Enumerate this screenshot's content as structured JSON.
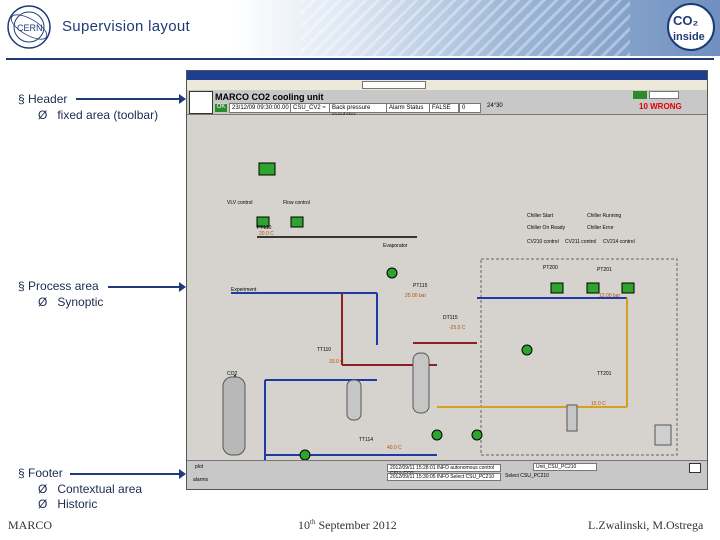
{
  "header": {
    "title": "Supervision layout"
  },
  "bullets": {
    "header": "Header",
    "header_sub": "fixed area (toolbar)",
    "process": "Process area",
    "process_sub": "Synoptic",
    "footer": "Footer",
    "footer_sub1": "Contextual area",
    "footer_sub2": "Historic"
  },
  "footer": {
    "left": "MARCO",
    "center_day": "10",
    "center_sup": "th",
    "center_rest": " September 2012",
    "right": "L.Zwalinski, M.Ostrega"
  },
  "screenshot": {
    "app_title": "MARCO CO2 cooling unit",
    "field_ok": "OK",
    "field_date": "23/12/09 09:30:00.00",
    "field_unit": "CSU_CV2 ≈",
    "field_regulator": "Back pressure regulator",
    "field_alarm": "Alarm Status",
    "field_false": "FALSE",
    "field_n": "0",
    "value_temp": "24°30",
    "value_red": "10 WRONG",
    "footer_left": "plot",
    "footer_alarms": "alarms",
    "footer_unit": "Unit_CSU_PC210",
    "footer_select": "Select CSU_PC210",
    "log1": "2012/09/11 15:28:01  INFO  autonomous control CSU: CO2",
    "log2": "2012/09/11 15:30:05  INFO  Select CSU_PC210",
    "labels": {
      "experiment": "Experiment",
      "pt110": "PT110",
      "pt115": "PT115",
      "tt110": "TT110",
      "co2": "CO2",
      "dt115": "DT115",
      "tt114": "TT114",
      "pt200": "PT200",
      "tt201": "TT201",
      "pt201": "PT201",
      "evaporator": "Evaporator",
      "chiller_start": "Chiller Start",
      "chiller_running": "Chiller Running",
      "chiller_on_ready": "Chiller On Ready",
      "chiller_error": "Chiller Error",
      "cv210": "CV210 control",
      "cv211": "CV211 control",
      "cv214": "CV214 control",
      "vlv_control": "VLV control",
      "flow_control": "Flow control",
      "temp1": "20.0 C",
      "temp2": "33.0 C",
      "temp3": "-25.0 C",
      "press1": "25.00 bar",
      "press2": "12.00 bar",
      "temp4": "15.0 C",
      "temp5": "40.0 C"
    }
  }
}
